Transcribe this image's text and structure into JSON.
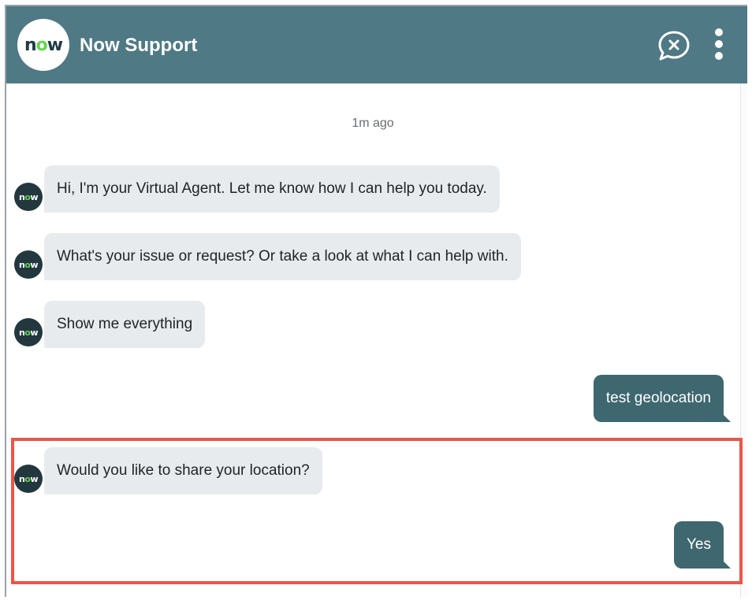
{
  "header": {
    "logo_text_n": "n",
    "logo_text_o": "o",
    "logo_text_w": "w",
    "title": "Now Support",
    "end_chat_icon": "end-chat-icon",
    "more_icon": "vertical-ellipsis-icon",
    "background_color": "#4e7985"
  },
  "chat": {
    "timestamp": "1m ago",
    "messages": [
      {
        "sender": "agent",
        "text": "Hi, I'm your Virtual Agent. Let me know how I can help you today."
      },
      {
        "sender": "agent",
        "text": "What's your issue or request? Or take a look at what I can help with."
      },
      {
        "sender": "agent",
        "text": "Show me everything"
      },
      {
        "sender": "user",
        "text": "test geolocation"
      },
      {
        "sender": "agent",
        "text": "Would you like to share your location?"
      },
      {
        "sender": "user",
        "text": "Yes"
      }
    ],
    "agent_bubble_color": "#e8ebee",
    "user_bubble_color": "#3e6770"
  },
  "annotation": {
    "highlight_color": "#ee5547"
  }
}
